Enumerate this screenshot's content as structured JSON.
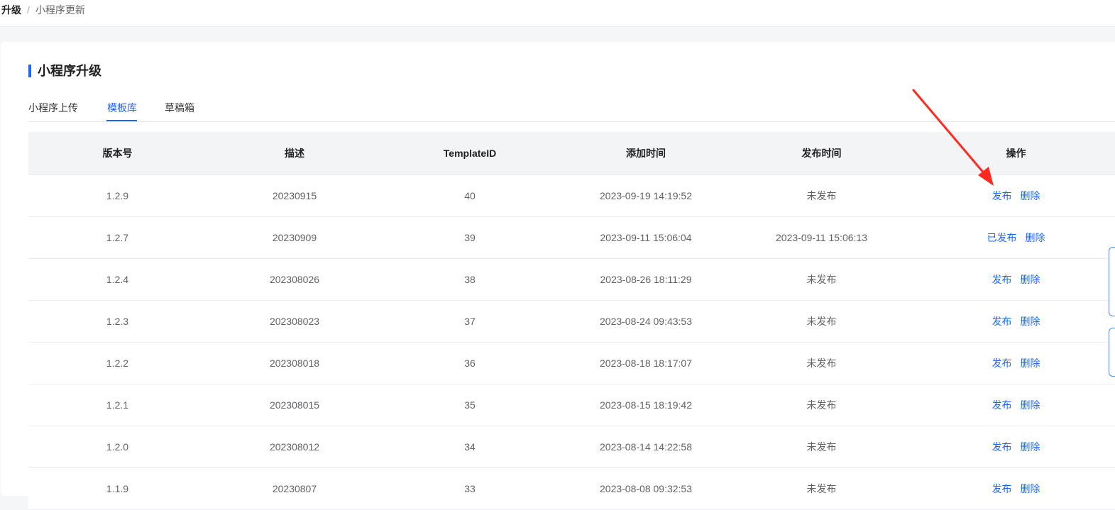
{
  "breadcrumb": {
    "root": "升级",
    "separator": "/",
    "current": "小程序更新"
  },
  "page": {
    "title": "小程序升级"
  },
  "tabs": [
    {
      "label": "小程序上传",
      "active": false
    },
    {
      "label": "模板库",
      "active": true
    },
    {
      "label": "草稿箱",
      "active": false
    }
  ],
  "table": {
    "headers": [
      "版本号",
      "描述",
      "TemplateID",
      "添加时间",
      "发布时间",
      "操作"
    ],
    "rows": [
      {
        "version": "1.2.9",
        "desc": "20230915",
        "template_id": "40",
        "added": "2023-09-19 14:19:52",
        "published": "未发布",
        "action": "发布",
        "delete": "删除"
      },
      {
        "version": "1.2.7",
        "desc": "20230909",
        "template_id": "39",
        "added": "2023-09-11 15:06:04",
        "published": "2023-09-11 15:06:13",
        "action": "已发布",
        "delete": "删除"
      },
      {
        "version": "1.2.4",
        "desc": "202308026",
        "template_id": "38",
        "added": "2023-08-26 18:11:29",
        "published": "未发布",
        "action": "发布",
        "delete": "删除"
      },
      {
        "version": "1.2.3",
        "desc": "202308023",
        "template_id": "37",
        "added": "2023-08-24 09:43:53",
        "published": "未发布",
        "action": "发布",
        "delete": "删除"
      },
      {
        "version": "1.2.2",
        "desc": "202308018",
        "template_id": "36",
        "added": "2023-08-18 18:17:07",
        "published": "未发布",
        "action": "发布",
        "delete": "删除"
      },
      {
        "version": "1.2.1",
        "desc": "202308015",
        "template_id": "35",
        "added": "2023-08-15 18:19:42",
        "published": "未发布",
        "action": "发布",
        "delete": "删除"
      },
      {
        "version": "1.2.0",
        "desc": "202308012",
        "template_id": "34",
        "added": "2023-08-14 14:22:58",
        "published": "未发布",
        "action": "发布",
        "delete": "删除"
      },
      {
        "version": "1.1.9",
        "desc": "20230807",
        "template_id": "33",
        "added": "2023-08-08 09:32:53",
        "published": "未发布",
        "action": "发布",
        "delete": "删除"
      }
    ]
  },
  "colors": {
    "accent": "#1a66ff",
    "annotation_arrow": "#ff2a1f"
  }
}
